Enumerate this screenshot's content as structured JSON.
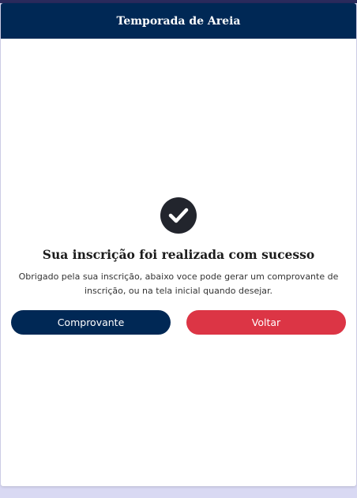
{
  "header": {
    "title": "Temporada de Areia"
  },
  "success": {
    "icon": "check-circle-icon",
    "title": "Sua inscrição foi realizada com sucesso",
    "message": "Obrigado pela sua inscrição, abaixo voce pode gerar um comprovante de inscrição, ou na tela inicial quando desejar."
  },
  "actions": {
    "receipt_label": "Comprovante",
    "back_label": "Voltar"
  },
  "colors": {
    "header_bg": "#002855",
    "primary_button": "#002855",
    "danger_button": "#dc3545",
    "icon_bg": "#22252d"
  }
}
